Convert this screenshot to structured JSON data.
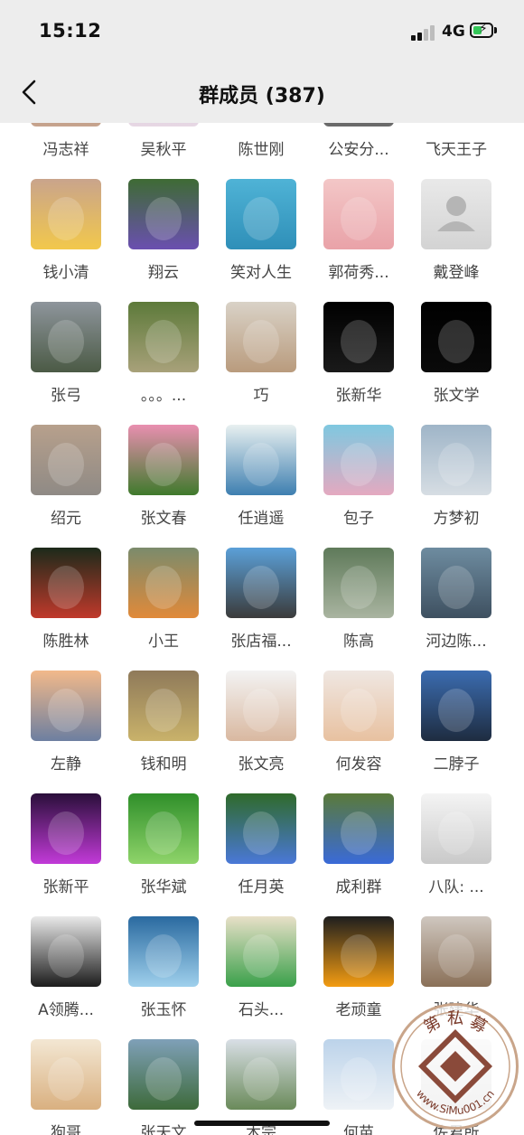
{
  "status_bar": {
    "time": "15:12",
    "network": "4G"
  },
  "nav": {
    "title": "群成员 (387)",
    "back_icon": "chevron-left-icon"
  },
  "members": [
    {
      "name": "冯志祥",
      "c1": "#8a6b5a",
      "c2": "#c7a48e"
    },
    {
      "name": "吴秋平",
      "c1": "#b6a8c8",
      "c2": "#e7d8e4"
    },
    {
      "name": "陈世刚",
      "c1": "#ffffff",
      "c2": "#ffffff"
    },
    {
      "name": "公安分...",
      "c1": "#3a3a3a",
      "c2": "#6b6b6b"
    },
    {
      "name": "飞天王子",
      "c1": "#ffffff",
      "c2": "#ffffff"
    },
    {
      "name": "钱小清",
      "c1": "#c9a48c",
      "c2": "#f2c84b"
    },
    {
      "name": "翔云",
      "c1": "#3e6b34",
      "c2": "#6a4fb0"
    },
    {
      "name": "笑对人生",
      "c1": "#4fb3d6",
      "c2": "#2f8fb8"
    },
    {
      "name": "郭荷秀...",
      "c1": "#f3c7c7",
      "c2": "#e9a2a8"
    },
    {
      "name": "戴登峰",
      "c1": "#e9e9e9",
      "c2": "#d3d3d3"
    },
    {
      "name": "张弓",
      "c1": "#8e959c",
      "c2": "#4b5a45"
    },
    {
      "name": "。。。...",
      "c1": "#5d7a3a",
      "c2": "#a8a17a"
    },
    {
      "name": "巧",
      "c1": "#d9d2c7",
      "c2": "#b99b7d"
    },
    {
      "name": "张新华",
      "c1": "#000000",
      "c2": "#1a1a1a"
    },
    {
      "name": "张文学",
      "c1": "#000000",
      "c2": "#0a0a0a"
    },
    {
      "name": "绍元",
      "c1": "#b7a08c",
      "c2": "#8f8a85"
    },
    {
      "name": "张文春",
      "c1": "#e98fb0",
      "c2": "#3f7a2c"
    },
    {
      "name": "任逍遥",
      "c1": "#e8f0f0",
      "c2": "#3e7fb0"
    },
    {
      "name": "包子",
      "c1": "#7fc8e0",
      "c2": "#e4a9c0"
    },
    {
      "name": "方梦初",
      "c1": "#9fb5c8",
      "c2": "#d6dde3"
    },
    {
      "name": "陈胜林",
      "c1": "#1c2a1a",
      "c2": "#c0392b"
    },
    {
      "name": "小王",
      "c1": "#7b8b6c",
      "c2": "#e08a3a"
    },
    {
      "name": "张店福...",
      "c1": "#5ba0d8",
      "c2": "#3b3b3b"
    },
    {
      "name": "陈高",
      "c1": "#5f7a5a",
      "c2": "#a9b4a0"
    },
    {
      "name": "河边陈...",
      "c1": "#6e8ca0",
      "c2": "#3e5060"
    },
    {
      "name": "左静",
      "c1": "#f2b98a",
      "c2": "#6d7fa0"
    },
    {
      "name": "钱和明",
      "c1": "#8f7a5a",
      "c2": "#c9b26a"
    },
    {
      "name": "张文亮",
      "c1": "#f3f3f3",
      "c2": "#d9b8a0"
    },
    {
      "name": "何发容",
      "c1": "#efe7e2",
      "c2": "#e8c1a0"
    },
    {
      "name": "二脖子",
      "c1": "#3b6cb0",
      "c2": "#1e2c40"
    },
    {
      "name": "张新平",
      "c1": "#2a0f3a",
      "c2": "#c23ad8"
    },
    {
      "name": "张华斌",
      "c1": "#2f8f2a",
      "c2": "#8fd46a"
    },
    {
      "name": "任月英",
      "c1": "#2f6a2a",
      "c2": "#4a78d8"
    },
    {
      "name": "成利群",
      "c1": "#5a7a3a",
      "c2": "#3a6ad8"
    },
    {
      "name": "八队: ...",
      "c1": "#f4f4f4",
      "c2": "#c9c9c9"
    },
    {
      "name": "A领腾...",
      "c1": "#e9e9e9",
      "c2": "#1c1c1c"
    },
    {
      "name": "张玉怀",
      "c1": "#2a6aa0",
      "c2": "#9fd0ec"
    },
    {
      "name": "石头...",
      "c1": "#e8e0c8",
      "c2": "#3aa04a"
    },
    {
      "name": "老顽童",
      "c1": "#1e1e1e",
      "c2": "#f39c12"
    },
    {
      "name": "张建华",
      "c1": "#cfc7bf",
      "c2": "#8a7058"
    },
    {
      "name": "狗哥",
      "c1": "#f3e7d3",
      "c2": "#d9b080"
    },
    {
      "name": "张天文",
      "c1": "#7fa0b8",
      "c2": "#3d6a3a"
    },
    {
      "name": "木宗",
      "c1": "#d9dfe6",
      "c2": "#6a8a5a"
    },
    {
      "name": "何苗",
      "c1": "#bcd3ea",
      "c2": "#eef2f6"
    },
    {
      "name": "佐君所",
      "c1": "#e8e8e8",
      "c2": "#c8c8c8"
    }
  ],
  "watermark": {
    "top_text": "第 私 募",
    "bottom_text": "www.SiMu001.cn"
  },
  "colors": {
    "header_bg": "#ededed",
    "accent_green": "#35c759",
    "watermark_brown": "#8a4a3a"
  }
}
